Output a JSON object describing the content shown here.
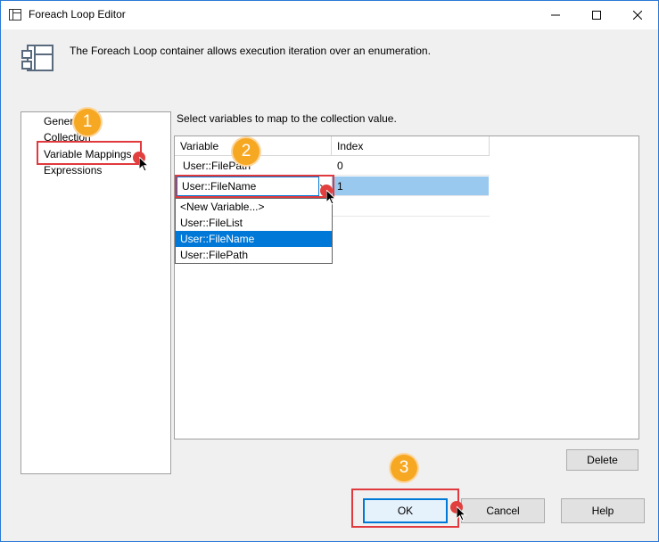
{
  "window": {
    "title": "Foreach Loop Editor"
  },
  "header": {
    "description": "The Foreach Loop container allows execution iteration over an enumeration."
  },
  "nav": {
    "items": [
      "General",
      "Collection",
      "Variable Mappings",
      "Expressions"
    ]
  },
  "main": {
    "instruction": "Select variables to map to the collection value.",
    "columns": [
      "Variable",
      "Index"
    ],
    "rows": [
      {
        "variable": "User::FilePath",
        "index": "0"
      },
      {
        "variable": "User::FileName",
        "index": "1"
      }
    ],
    "dropdown_options": [
      "<New Variable...>",
      "User::FileList",
      "User::FileName",
      "User::FilePath"
    ],
    "selected_option": "User::FileName"
  },
  "buttons": {
    "delete": "Delete",
    "ok": "OK",
    "cancel": "Cancel",
    "help": "Help"
  },
  "steps": [
    "1",
    "2",
    "3"
  ],
  "colors": {
    "accent": "#0078d7",
    "highlight": "#e0393e",
    "step": "#f7a823"
  }
}
